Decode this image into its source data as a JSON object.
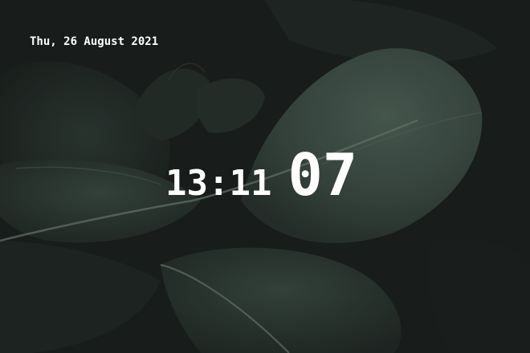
{
  "wallpaper": {
    "icon": "leaf-wallpaper",
    "colors": {
      "leaf_dark": "#26302b",
      "leaf_mid": "#3b4b43",
      "leaf_light": "#4f6258",
      "vein": "#6d7f72",
      "background": "#1c201e"
    }
  },
  "clock": {
    "date": "Thu, 26 August 2021",
    "hours_minutes": "13:11",
    "seconds": "07",
    "text_color": "#ffffff"
  }
}
